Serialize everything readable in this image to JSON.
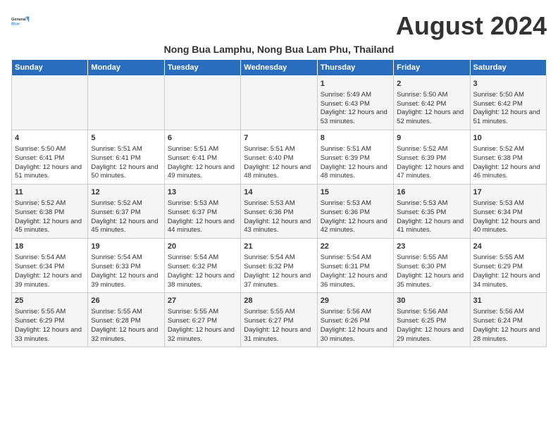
{
  "logo": {
    "line1": "General",
    "line2": "Blue"
  },
  "title": "August 2024",
  "location": "Nong Bua Lamphu, Nong Bua Lam Phu, Thailand",
  "days_of_week": [
    "Sunday",
    "Monday",
    "Tuesday",
    "Wednesday",
    "Thursday",
    "Friday",
    "Saturday"
  ],
  "weeks": [
    [
      {
        "day": "",
        "sunrise": "",
        "sunset": "",
        "daylight": ""
      },
      {
        "day": "",
        "sunrise": "",
        "sunset": "",
        "daylight": ""
      },
      {
        "day": "",
        "sunrise": "",
        "sunset": "",
        "daylight": ""
      },
      {
        "day": "",
        "sunrise": "",
        "sunset": "",
        "daylight": ""
      },
      {
        "day": "1",
        "sunrise": "Sunrise: 5:49 AM",
        "sunset": "Sunset: 6:43 PM",
        "daylight": "Daylight: 12 hours and 53 minutes."
      },
      {
        "day": "2",
        "sunrise": "Sunrise: 5:50 AM",
        "sunset": "Sunset: 6:42 PM",
        "daylight": "Daylight: 12 hours and 52 minutes."
      },
      {
        "day": "3",
        "sunrise": "Sunrise: 5:50 AM",
        "sunset": "Sunset: 6:42 PM",
        "daylight": "Daylight: 12 hours and 51 minutes."
      }
    ],
    [
      {
        "day": "4",
        "sunrise": "Sunrise: 5:50 AM",
        "sunset": "Sunset: 6:41 PM",
        "daylight": "Daylight: 12 hours and 51 minutes."
      },
      {
        "day": "5",
        "sunrise": "Sunrise: 5:51 AM",
        "sunset": "Sunset: 6:41 PM",
        "daylight": "Daylight: 12 hours and 50 minutes."
      },
      {
        "day": "6",
        "sunrise": "Sunrise: 5:51 AM",
        "sunset": "Sunset: 6:41 PM",
        "daylight": "Daylight: 12 hours and 49 minutes."
      },
      {
        "day": "7",
        "sunrise": "Sunrise: 5:51 AM",
        "sunset": "Sunset: 6:40 PM",
        "daylight": "Daylight: 12 hours and 48 minutes."
      },
      {
        "day": "8",
        "sunrise": "Sunrise: 5:51 AM",
        "sunset": "Sunset: 6:39 PM",
        "daylight": "Daylight: 12 hours and 48 minutes."
      },
      {
        "day": "9",
        "sunrise": "Sunrise: 5:52 AM",
        "sunset": "Sunset: 6:39 PM",
        "daylight": "Daylight: 12 hours and 47 minutes."
      },
      {
        "day": "10",
        "sunrise": "Sunrise: 5:52 AM",
        "sunset": "Sunset: 6:38 PM",
        "daylight": "Daylight: 12 hours and 46 minutes."
      }
    ],
    [
      {
        "day": "11",
        "sunrise": "Sunrise: 5:52 AM",
        "sunset": "Sunset: 6:38 PM",
        "daylight": "Daylight: 12 hours and 45 minutes."
      },
      {
        "day": "12",
        "sunrise": "Sunrise: 5:52 AM",
        "sunset": "Sunset: 6:37 PM",
        "daylight": "Daylight: 12 hours and 45 minutes."
      },
      {
        "day": "13",
        "sunrise": "Sunrise: 5:53 AM",
        "sunset": "Sunset: 6:37 PM",
        "daylight": "Daylight: 12 hours and 44 minutes."
      },
      {
        "day": "14",
        "sunrise": "Sunrise: 5:53 AM",
        "sunset": "Sunset: 6:36 PM",
        "daylight": "Daylight: 12 hours and 43 minutes."
      },
      {
        "day": "15",
        "sunrise": "Sunrise: 5:53 AM",
        "sunset": "Sunset: 6:36 PM",
        "daylight": "Daylight: 12 hours and 42 minutes."
      },
      {
        "day": "16",
        "sunrise": "Sunrise: 5:53 AM",
        "sunset": "Sunset: 6:35 PM",
        "daylight": "Daylight: 12 hours and 41 minutes."
      },
      {
        "day": "17",
        "sunrise": "Sunrise: 5:53 AM",
        "sunset": "Sunset: 6:34 PM",
        "daylight": "Daylight: 12 hours and 40 minutes."
      }
    ],
    [
      {
        "day": "18",
        "sunrise": "Sunrise: 5:54 AM",
        "sunset": "Sunset: 6:34 PM",
        "daylight": "Daylight: 12 hours and 39 minutes."
      },
      {
        "day": "19",
        "sunrise": "Sunrise: 5:54 AM",
        "sunset": "Sunset: 6:33 PM",
        "daylight": "Daylight: 12 hours and 39 minutes."
      },
      {
        "day": "20",
        "sunrise": "Sunrise: 5:54 AM",
        "sunset": "Sunset: 6:32 PM",
        "daylight": "Daylight: 12 hours and 38 minutes."
      },
      {
        "day": "21",
        "sunrise": "Sunrise: 5:54 AM",
        "sunset": "Sunset: 6:32 PM",
        "daylight": "Daylight: 12 hours and 37 minutes."
      },
      {
        "day": "22",
        "sunrise": "Sunrise: 5:54 AM",
        "sunset": "Sunset: 6:31 PM",
        "daylight": "Daylight: 12 hours and 36 minutes."
      },
      {
        "day": "23",
        "sunrise": "Sunrise: 5:55 AM",
        "sunset": "Sunset: 6:30 PM",
        "daylight": "Daylight: 12 hours and 35 minutes."
      },
      {
        "day": "24",
        "sunrise": "Sunrise: 5:55 AM",
        "sunset": "Sunset: 6:29 PM",
        "daylight": "Daylight: 12 hours and 34 minutes."
      }
    ],
    [
      {
        "day": "25",
        "sunrise": "Sunrise: 5:55 AM",
        "sunset": "Sunset: 6:29 PM",
        "daylight": "Daylight: 12 hours and 33 minutes."
      },
      {
        "day": "26",
        "sunrise": "Sunrise: 5:55 AM",
        "sunset": "Sunset: 6:28 PM",
        "daylight": "Daylight: 12 hours and 32 minutes."
      },
      {
        "day": "27",
        "sunrise": "Sunrise: 5:55 AM",
        "sunset": "Sunset: 6:27 PM",
        "daylight": "Daylight: 12 hours and 32 minutes."
      },
      {
        "day": "28",
        "sunrise": "Sunrise: 5:55 AM",
        "sunset": "Sunset: 6:27 PM",
        "daylight": "Daylight: 12 hours and 31 minutes."
      },
      {
        "day": "29",
        "sunrise": "Sunrise: 5:56 AM",
        "sunset": "Sunset: 6:26 PM",
        "daylight": "Daylight: 12 hours and 30 minutes."
      },
      {
        "day": "30",
        "sunrise": "Sunrise: 5:56 AM",
        "sunset": "Sunset: 6:25 PM",
        "daylight": "Daylight: 12 hours and 29 minutes."
      },
      {
        "day": "31",
        "sunrise": "Sunrise: 5:56 AM",
        "sunset": "Sunset: 6:24 PM",
        "daylight": "Daylight: 12 hours and 28 minutes."
      }
    ]
  ]
}
